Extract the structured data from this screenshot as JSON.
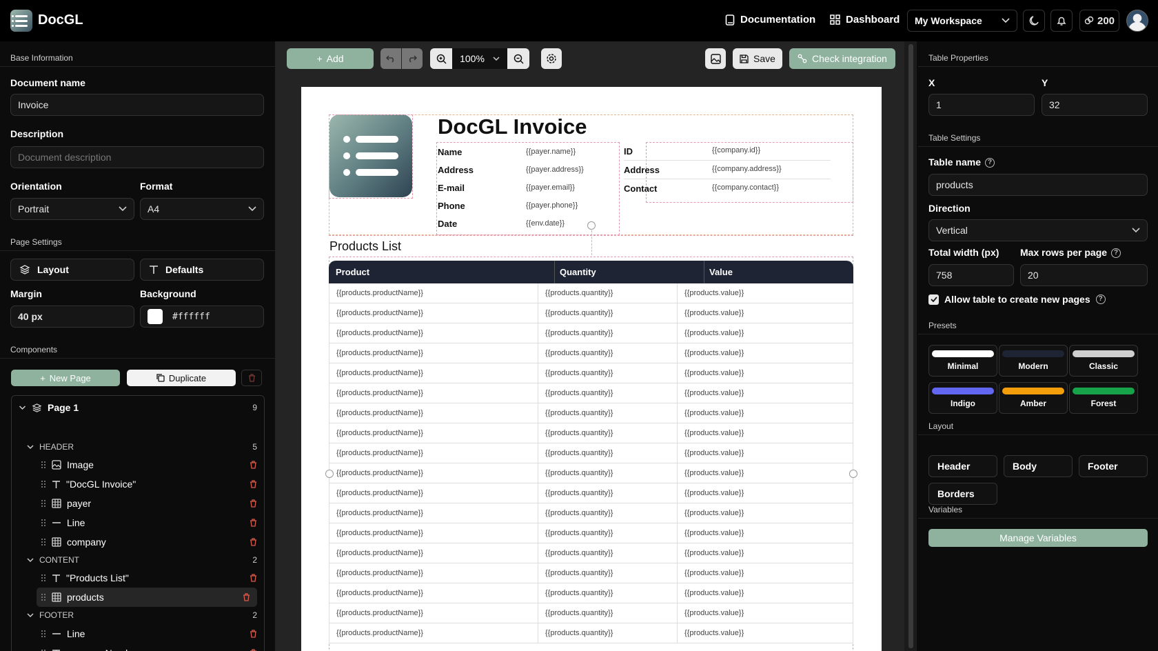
{
  "app": {
    "name": "DocGL"
  },
  "nav": {
    "documentation": "Documentation",
    "dashboard": "Dashboard",
    "workspace": "My Workspace",
    "credits": "200"
  },
  "left": {
    "base_info": "Base Information",
    "doc_name_label": "Document name",
    "doc_name_value": "Invoice",
    "description_label": "Description",
    "description_placeholder": "Document description",
    "orientation_label": "Orientation",
    "orientation_value": "Portrait",
    "format_label": "Format",
    "format_value": "A4",
    "page_settings": "Page Settings",
    "layout_btn": "Layout",
    "defaults_btn": "Defaults",
    "margin_label": "Margin",
    "margin_value": "40 px",
    "background_label": "Background",
    "background_value": "#ffffff",
    "components": "Components",
    "new_page": "New Page",
    "duplicate": "Duplicate",
    "tree": {
      "page": "Page 1",
      "page_count": "9",
      "header": "HEADER",
      "header_count": "5",
      "header_items": [
        "Image",
        "\"DocGL Invoice\"",
        "payer",
        "Line",
        "company"
      ],
      "content": "CONTENT",
      "content_count": "2",
      "content_items": [
        "\"Products List\"",
        "products"
      ],
      "footer": "FOOTER",
      "footer_count": "2",
      "footer_items": [
        "Line",
        "env.pageNumber"
      ]
    }
  },
  "toolbar": {
    "add": "Add",
    "zoom": "100%",
    "save": "Save",
    "check": "Check integration"
  },
  "invoice": {
    "title": "DocGL Invoice",
    "payer": [
      {
        "label": "Name",
        "value": "{{payer.name}}"
      },
      {
        "label": "Address",
        "value": "{{payer.address}}"
      },
      {
        "label": "E-mail",
        "value": "{{payer.email}}"
      },
      {
        "label": "Phone",
        "value": "{{payer.phone}}"
      },
      {
        "label": "Date",
        "value": "{{env.date}}"
      }
    ],
    "company": [
      {
        "label": "ID",
        "value": "{{company.id}}"
      },
      {
        "label": "Address",
        "value": "{{company.address}}"
      },
      {
        "label": "Contact",
        "value": "{{company.contact}}"
      }
    ],
    "products_title": "Products List",
    "columns": [
      "Product",
      "Quantity",
      "Value"
    ],
    "row": [
      "{{products.productName}}",
      "{{products.quantity}}",
      "{{products.value}}"
    ],
    "row_count": 18
  },
  "right": {
    "table_properties": "Table Properties",
    "x_label": "X",
    "x_value": "1",
    "y_label": "Y",
    "y_value": "32",
    "table_settings": "Table Settings",
    "table_name_label": "Table name",
    "table_name_value": "products",
    "direction_label": "Direction",
    "direction_value": "Vertical",
    "total_width_label": "Total width (px)",
    "total_width_value": "758",
    "max_rows_label": "Max rows per page",
    "max_rows_value": "20",
    "allow_label": "Allow table to create new pages",
    "presets": "Presets",
    "preset_items": [
      {
        "name": "Minimal",
        "color": "#ffffff"
      },
      {
        "name": "Modern",
        "color": "#1e2433"
      },
      {
        "name": "Classic",
        "color": "#cfcfcf"
      },
      {
        "name": "Indigo",
        "color": "#6366f1"
      },
      {
        "name": "Amber",
        "color": "#f59e0b"
      },
      {
        "name": "Forest",
        "color": "#16a34a"
      }
    ],
    "layout": "Layout",
    "layout_items": [
      "Header",
      "Body",
      "Footer",
      "Borders"
    ],
    "variables": "Variables",
    "manage_variables": "Manage Variables"
  }
}
